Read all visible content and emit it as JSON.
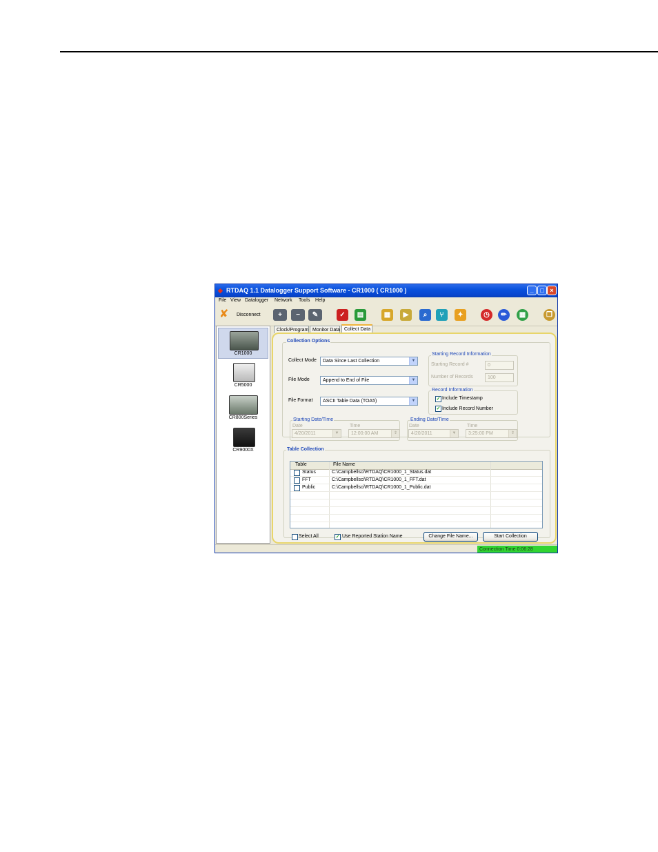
{
  "window": {
    "title": "RTDAQ 1.1 Datalogger Support Software - CR1000 ( CR1000 )",
    "title_controls": [
      "_",
      "□",
      "×"
    ]
  },
  "menu": [
    "File",
    "View",
    "Datalogger",
    "Network",
    "Tools",
    "Help"
  ],
  "toolbar": {
    "disconnect_label": "Disconnect",
    "icons": [
      "add-station-icon",
      "remove-station-icon",
      "edit-station-icon",
      "checklist-icon",
      "document-icon",
      "chart-icon",
      "run-program-icon",
      "find-icon",
      "network-icon",
      "clear-icon",
      "stop-icon",
      "pencil-icon",
      "calculator-icon",
      "window-icon"
    ]
  },
  "devices": [
    {
      "name": "CR1000",
      "selected": true
    },
    {
      "name": "CR5000",
      "selected": false
    },
    {
      "name": "CR800Series",
      "selected": false
    },
    {
      "name": "CR9000X",
      "selected": false
    }
  ],
  "tabs": [
    "Clock/Program",
    "Monitor Data",
    "Collect Data"
  ],
  "collection_options": {
    "title": "Collection Options",
    "collect_mode_label": "Collect Mode",
    "collect_mode_value": "Data Since Last Collection",
    "file_mode_label": "File Mode",
    "file_mode_value": "Append to End of File",
    "file_format_label": "File Format",
    "file_format_value": "ASCII Table Data (TOA5)"
  },
  "starting_record": {
    "title": "Starting Record Information",
    "starting_record_label": "Starting Record #",
    "starting_record_value": "0",
    "number_records_label": "Number of Records",
    "number_records_value": "100"
  },
  "record_information": {
    "title": "Record Information",
    "include_timestamp": "Include Timestamp",
    "include_record_number": "Include Record Number"
  },
  "starting_datetime": {
    "title": "Starting Date/Time",
    "date_label": "Date",
    "date_value": "4/20/2011",
    "time_label": "Time",
    "time_value": "12:00:00 AM"
  },
  "ending_datetime": {
    "title": "Ending Date/Time",
    "date_label": "Date",
    "date_value": "4/20/2011",
    "time_label": "Time",
    "time_value": "3:25:00 PM"
  },
  "table_collection": {
    "title": "Table Collection",
    "columns": [
      "Table",
      "File Name"
    ],
    "rows": [
      {
        "table": "Status",
        "file": "C:\\Campbellsci\\RTDAQ\\CR1000_1_Status.dat"
      },
      {
        "table": "FFT",
        "file": "C:\\Campbellsci\\RTDAQ\\CR1000_1_FFT.dat"
      },
      {
        "table": "Public",
        "file": "C:\\Campbellsci\\RTDAQ\\CR1000_1_Public.dat"
      }
    ]
  },
  "bottom": {
    "select_all": "Select All",
    "use_reported_station_name": "Use Reported Station Name",
    "change_file_name": "Change File Name...",
    "start_collection": "Start Collection"
  },
  "status": {
    "connection_time": "Connection Time 0:06:28"
  },
  "colors": {
    "title_bar": "#0a52dd",
    "connection_status": "#31d431",
    "group_label": "#1d47b8",
    "panel_border": "#e8d56a"
  }
}
